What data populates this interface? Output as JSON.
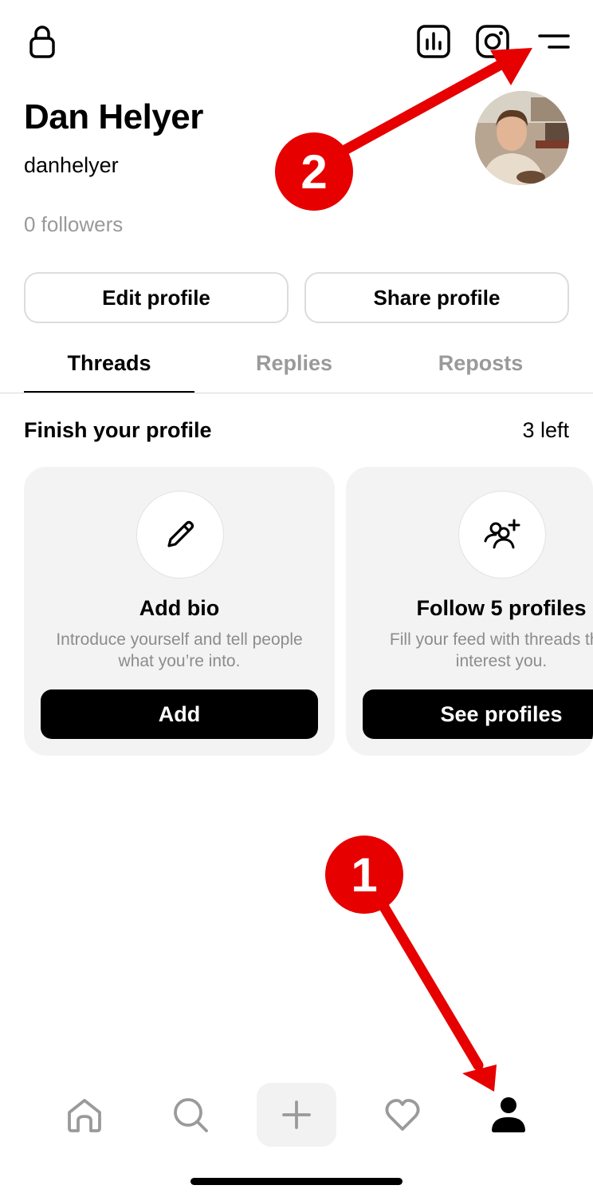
{
  "profile": {
    "name": "Dan Helyer",
    "handle": "danhelyer",
    "followers": "0 followers"
  },
  "buttons": {
    "edit_profile": "Edit profile",
    "share_profile": "Share profile"
  },
  "tabs": [
    {
      "label": "Threads",
      "active": true
    },
    {
      "label": "Replies",
      "active": false
    },
    {
      "label": "Reposts",
      "active": false
    }
  ],
  "finish": {
    "title": "Finish your profile",
    "count": "3 left"
  },
  "cards": [
    {
      "icon": "pencil-icon",
      "title": "Add bio",
      "desc": "Introduce yourself and tell people what you’re into.",
      "action": "Add"
    },
    {
      "icon": "follow-people-icon",
      "title": "Follow 5 profiles",
      "desc": "Fill your feed with threads that interest you.",
      "action": "See profiles"
    }
  ],
  "top_icons": [
    "lock-icon",
    "insights-icon",
    "instagram-icon",
    "menu-icon"
  ],
  "nav_icons": [
    "home-icon",
    "search-icon",
    "plus-icon",
    "heart-icon",
    "profile-icon"
  ],
  "annotations": {
    "badge_1": "1",
    "badge_2": "2",
    "color": "#e60000"
  }
}
